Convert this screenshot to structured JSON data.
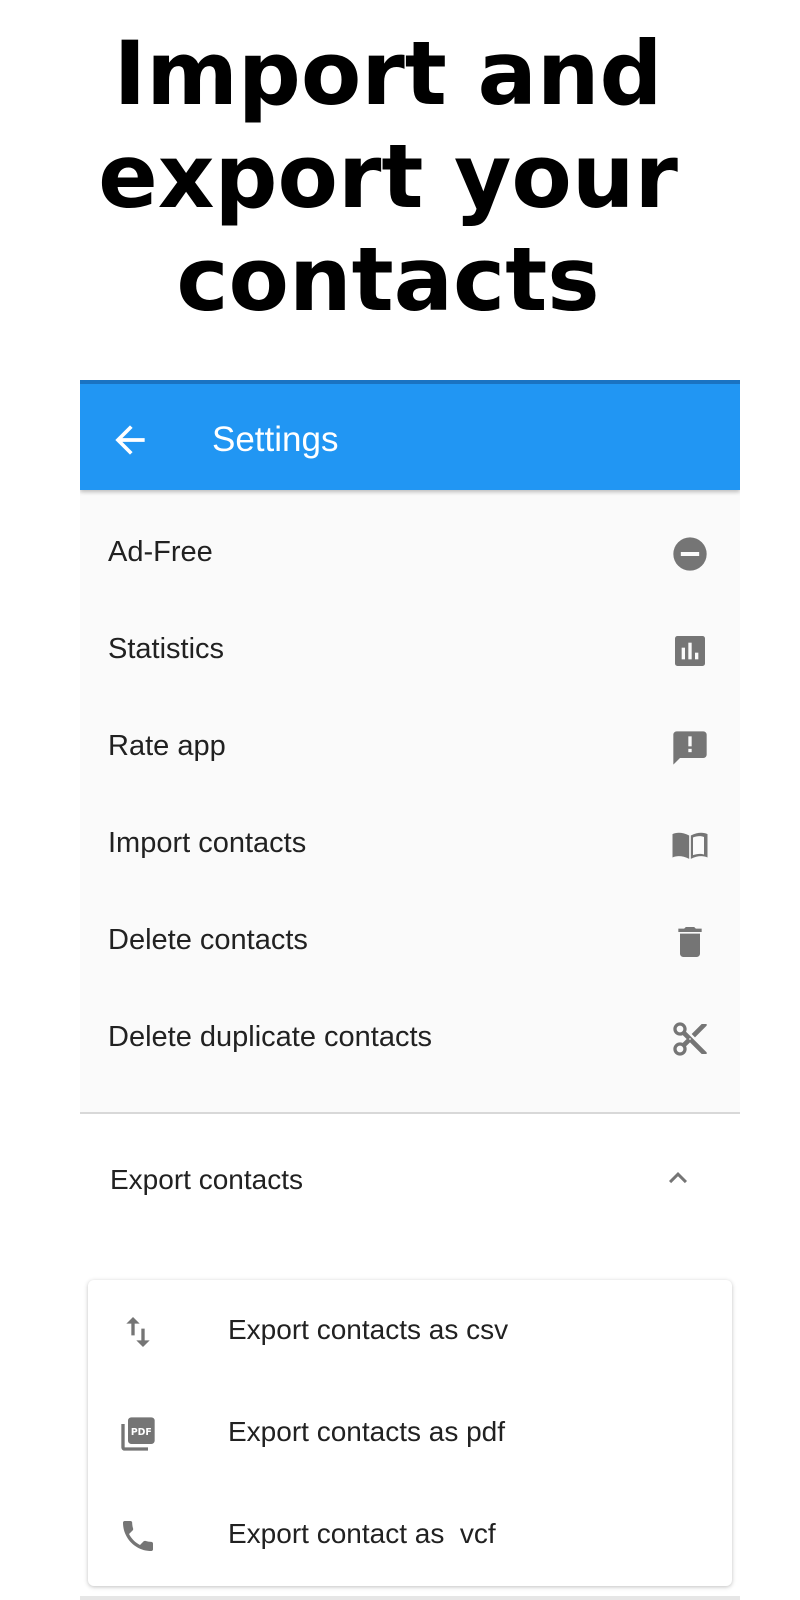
{
  "headline": {
    "line1": "Import and",
    "line2": "export your",
    "line3": "contacts"
  },
  "appbar": {
    "title": "Settings",
    "back_icon": "arrow-back-icon",
    "color": "#2196f3"
  },
  "settings": {
    "items": [
      {
        "label": "Ad-Free",
        "icon": "remove-circle-icon"
      },
      {
        "label": "Statistics",
        "icon": "bar-chart-icon"
      },
      {
        "label": "Rate app",
        "icon": "feedback-icon"
      },
      {
        "label": "Import contacts",
        "icon": "book-icon"
      },
      {
        "label": "Delete contacts",
        "icon": "trash-icon"
      },
      {
        "label": "Delete duplicate contacts",
        "icon": "scissors-icon"
      }
    ]
  },
  "export": {
    "label": "Export contacts",
    "expanded": true,
    "chevron_icon": "chevron-up-icon",
    "options": [
      {
        "label": "Export contacts as csv",
        "icon": "import-export-icon"
      },
      {
        "label": "Export contacts as pdf",
        "icon": "pdf-icon"
      },
      {
        "label": "Export contact as  vcf",
        "icon": "phone-icon"
      }
    ]
  }
}
